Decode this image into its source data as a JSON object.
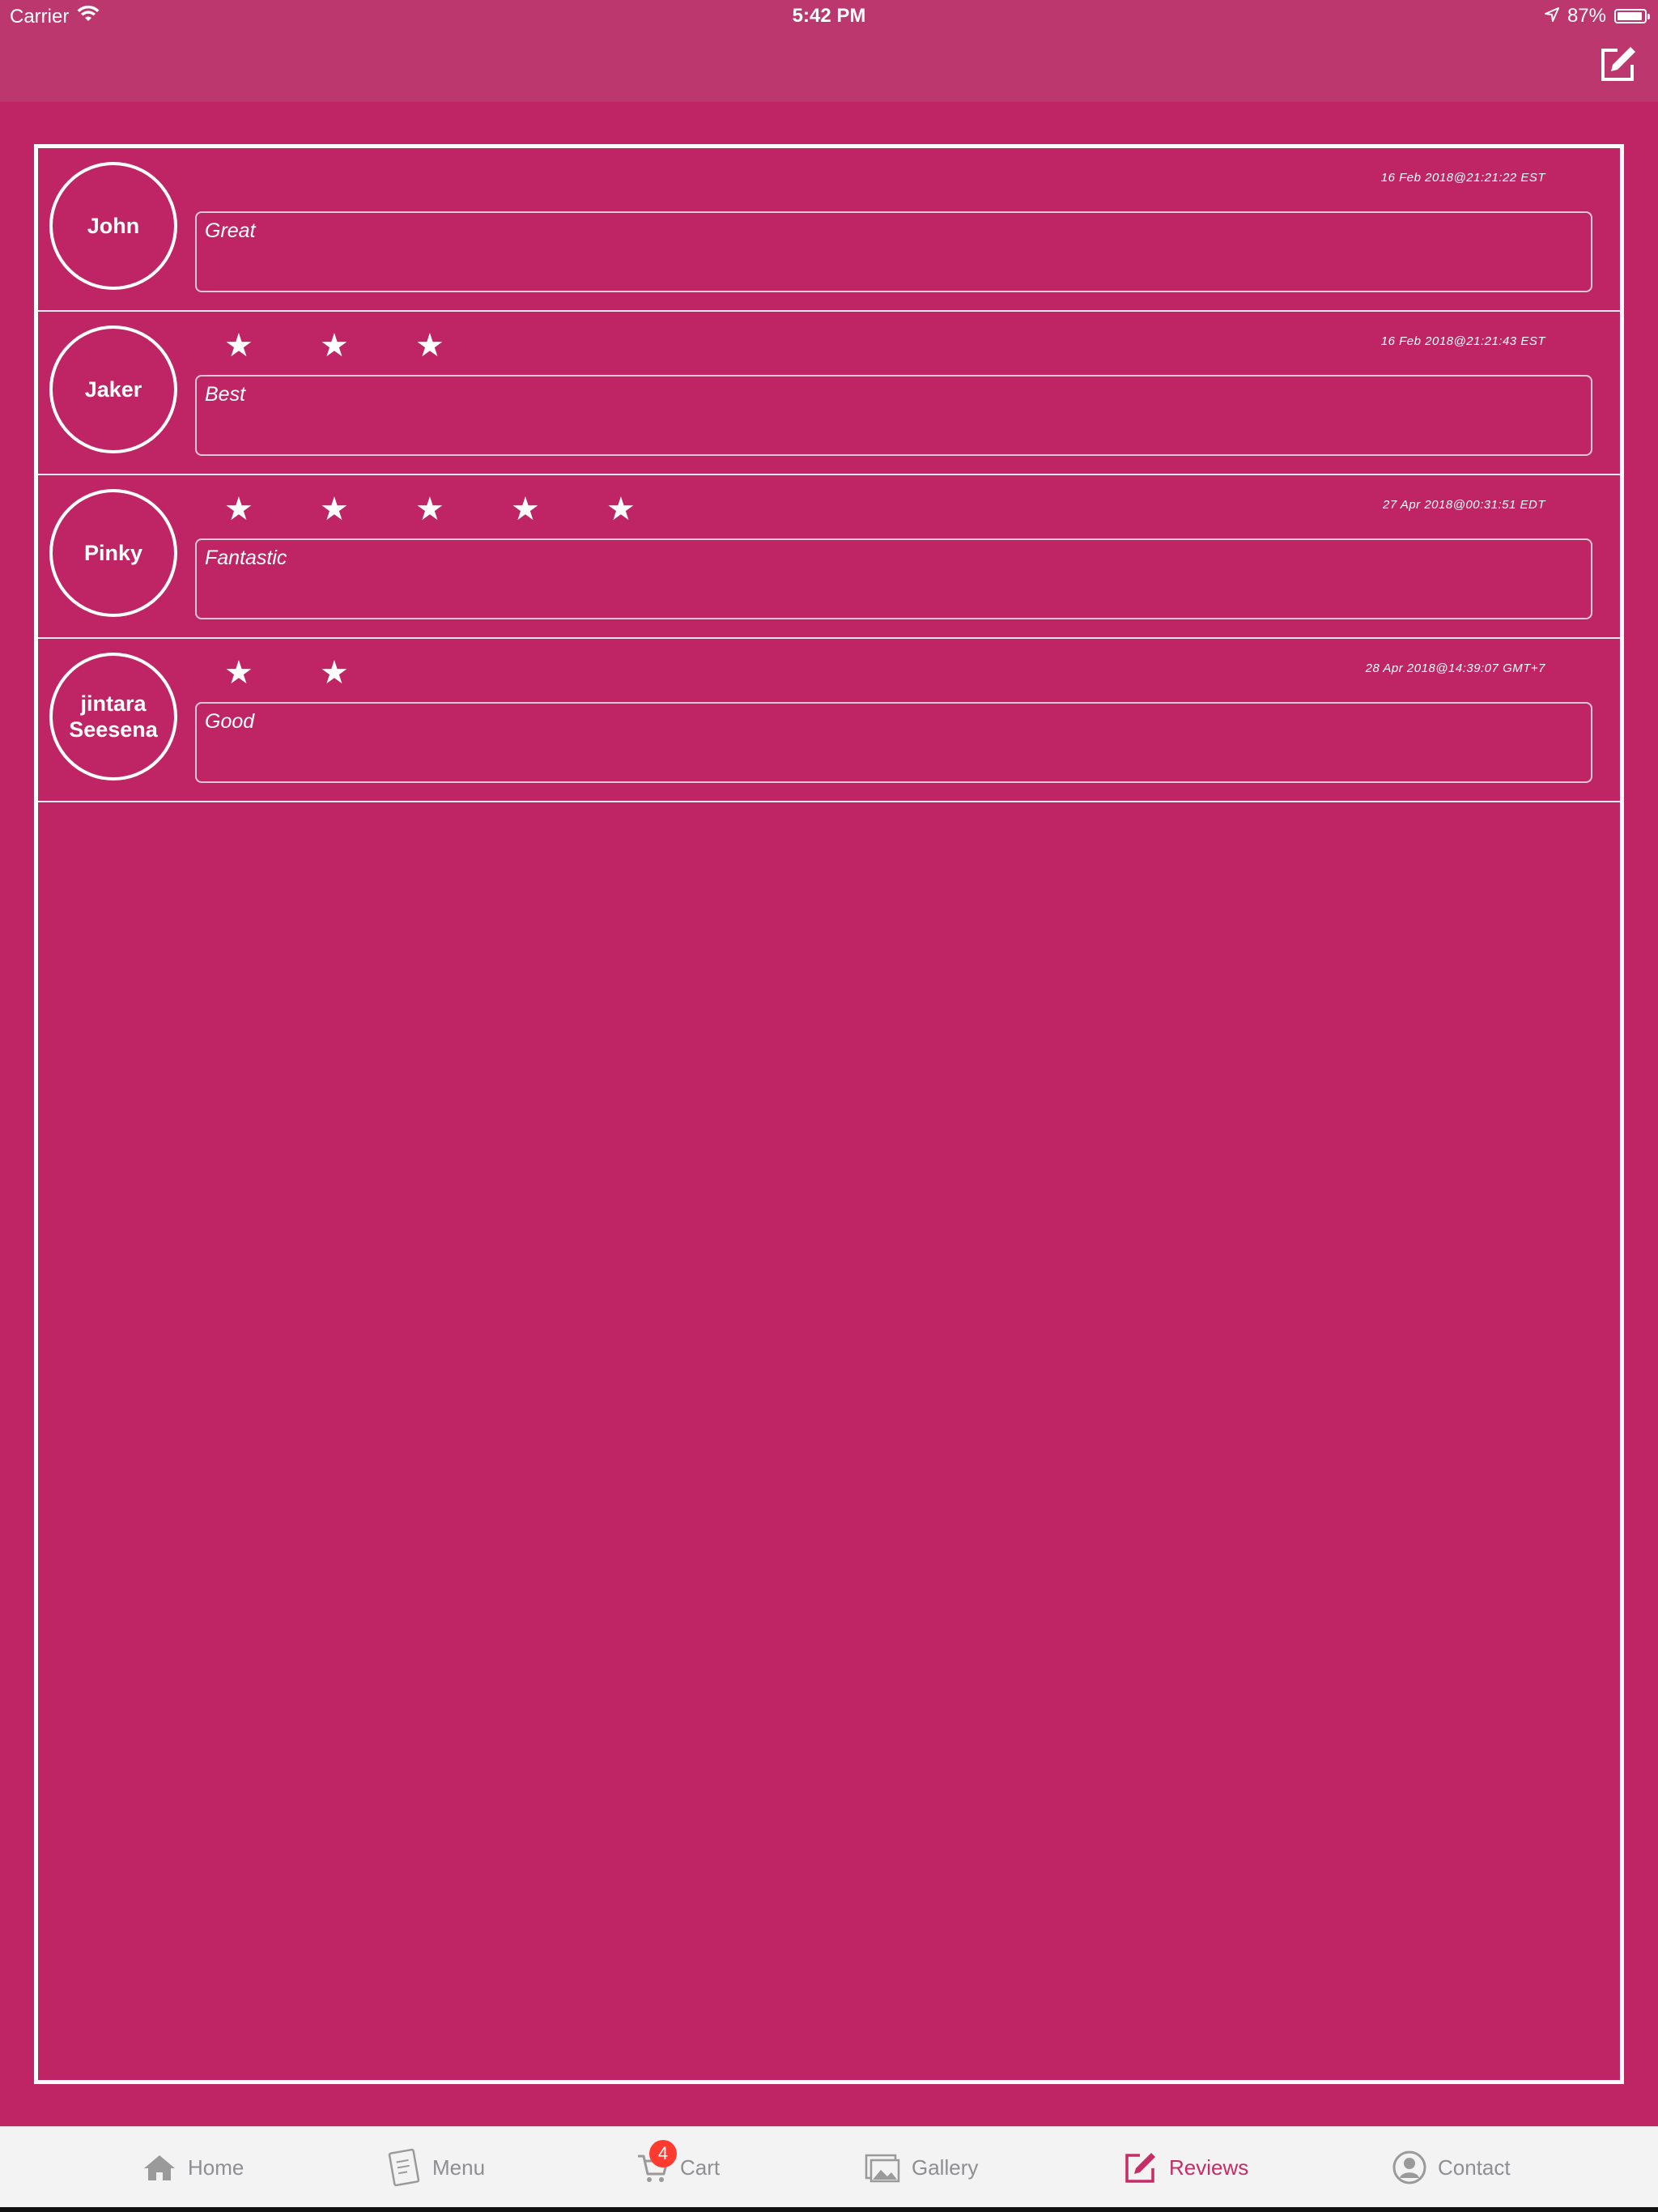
{
  "status_bar": {
    "carrier": "Carrier",
    "time": "5:42 PM",
    "battery": "87%",
    "wifi_icon": "wifi-icon",
    "location_icon": "location-arrow-icon",
    "battery_level": 0.87
  },
  "nav": {
    "compose_icon": "compose-icon"
  },
  "reviews": [
    {
      "name": "John",
      "stars": 0,
      "timestamp": "16 Feb 2018@21:21:22 EST",
      "comment": "Great"
    },
    {
      "name": "Jaker",
      "stars": 3,
      "timestamp": "16 Feb 2018@21:21:43 EST",
      "comment": "Best"
    },
    {
      "name": "Pinky",
      "stars": 5,
      "timestamp": "27 Apr 2018@00:31:51 EDT",
      "comment": "Fantastic"
    },
    {
      "name": "jintara Seesena",
      "stars": 2,
      "timestamp": "28 Apr 2018@14:39:07 GMT+7",
      "comment": "Good"
    }
  ],
  "tabbar": {
    "home": "Home",
    "menu": "Menu",
    "cart": "Cart",
    "cart_badge": "4",
    "gallery": "Gallery",
    "reviews": "Reviews",
    "contact": "Contact"
  },
  "colors": {
    "background": "#bf2564",
    "header": "#bb376d",
    "active_tab": "#c62c66",
    "inactive_tab": "#8e8e93",
    "badge": "#ff3b30"
  }
}
